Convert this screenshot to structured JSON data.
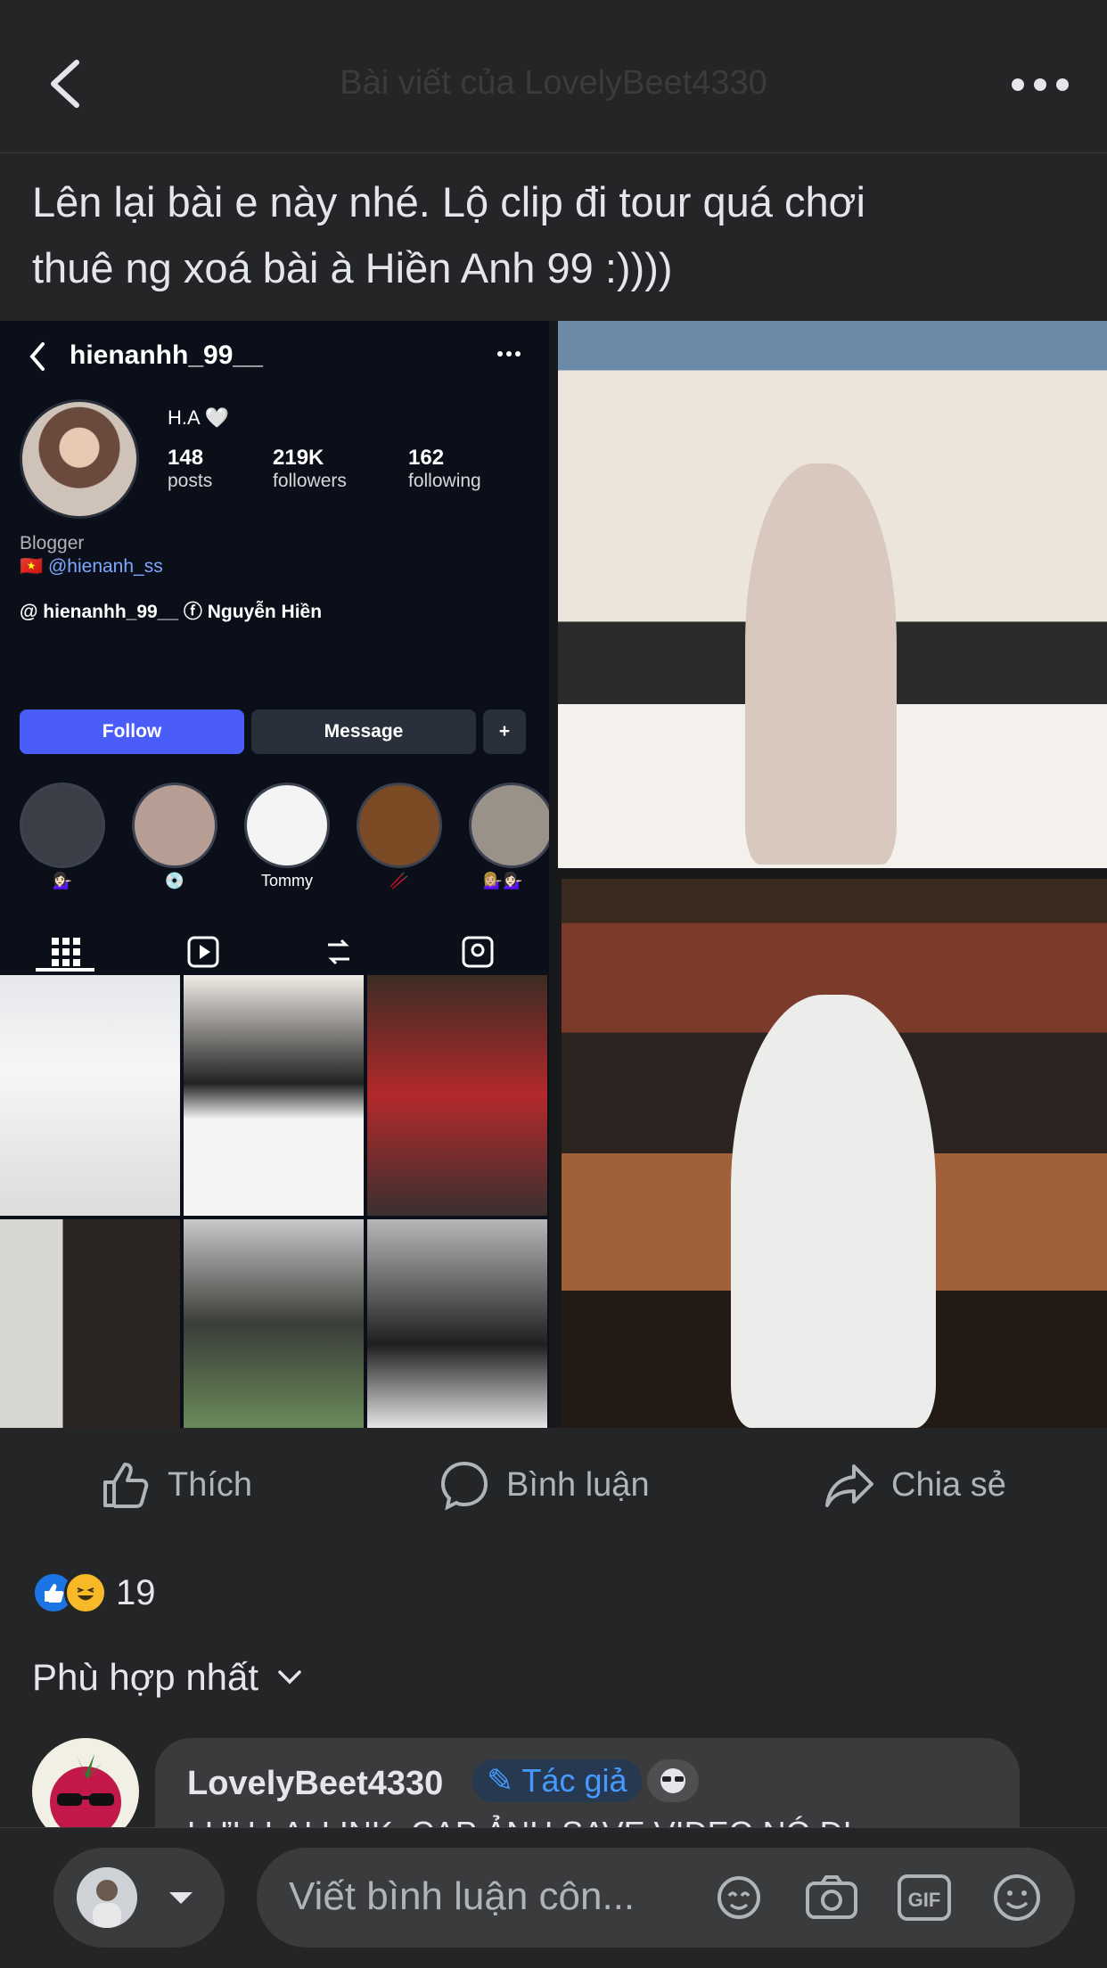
{
  "header": {
    "title_faded": "Bài viết của LovelyBeet4330",
    "back_icon": "chevron-left-icon",
    "more_icon": "more-horizontal-icon"
  },
  "post": {
    "text_line1": "Lên lại bài e này nhé. Lộ clip đi tour quá chơi",
    "text_line2": "thuê ng xoá bài à Hiền Anh 99 :))))"
  },
  "instagram_screenshot": {
    "username": "hienanhh_99__",
    "name": "H.A 🤍",
    "stats": [
      {
        "value": "148",
        "label": "posts"
      },
      {
        "value": "219K",
        "label": "followers"
      },
      {
        "value": "162",
        "label": "following"
      }
    ],
    "bio_category": "Blogger",
    "bio_handle": "🇻🇳 @hienanh_ss",
    "links": "@ hienanhh_99__   ⓕ Nguyễn Hiền",
    "follow_label": "Follow",
    "message_label": "Message",
    "highlights": [
      "💁🏻‍♀️",
      "💿",
      "Tommy",
      "🥢",
      "💁🏼‍♀️💁🏻‍♀️"
    ]
  },
  "actions": {
    "like": "Thích",
    "comment": "Bình luận",
    "share": "Chia sẻ"
  },
  "reactions": {
    "count": "19",
    "types": [
      "like",
      "haha"
    ]
  },
  "sort": {
    "label": "Phù hợp nhất"
  },
  "comment": {
    "author": "LovelyBeet4330",
    "badge": "Tác giả",
    "text_partial": "LƯU LẠI LINK, CAP ẢNH SAVE VIDEO NÓ ĐI"
  },
  "composer": {
    "placeholder": "Viết bình luận côn..."
  },
  "colors": {
    "background": "#242526",
    "text": "#e4e6eb",
    "muted": "#b0b3b8",
    "accent": "#1b74e4",
    "ig_follow": "#4a5df9"
  }
}
